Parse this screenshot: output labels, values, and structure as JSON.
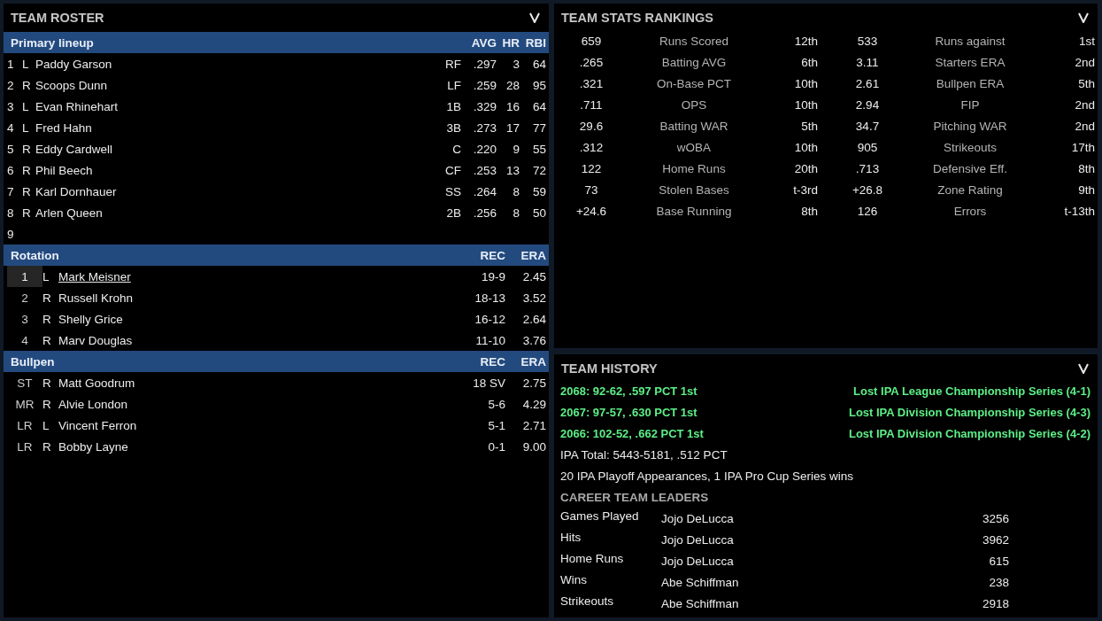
{
  "roster": {
    "title": "TEAM ROSTER",
    "sections": [
      {
        "kind": "lineup",
        "title": "Primary lineup",
        "columns": [
          "AVG",
          "HR",
          "RBI"
        ],
        "rows": [
          {
            "slot": "1",
            "hand": "L",
            "name": "Paddy Garson",
            "pos": "RF",
            "avg": ".297",
            "hr": "3",
            "rbi": "64",
            "selected": false
          },
          {
            "slot": "2",
            "hand": "R",
            "name": "Scoops Dunn",
            "pos": "LF",
            "avg": ".259",
            "hr": "28",
            "rbi": "95",
            "selected": false
          },
          {
            "slot": "3",
            "hand": "L",
            "name": "Evan Rhinehart",
            "pos": "1B",
            "avg": ".329",
            "hr": "16",
            "rbi": "64",
            "selected": false
          },
          {
            "slot": "4",
            "hand": "L",
            "name": "Fred Hahn",
            "pos": "3B",
            "avg": ".273",
            "hr": "17",
            "rbi": "77",
            "selected": false
          },
          {
            "slot": "5",
            "hand": "R",
            "name": "Eddy Cardwell",
            "pos": "C",
            "avg": ".220",
            "hr": "9",
            "rbi": "55",
            "selected": false
          },
          {
            "slot": "6",
            "hand": "R",
            "name": "Phil Beech",
            "pos": "CF",
            "avg": ".253",
            "hr": "13",
            "rbi": "72",
            "selected": false
          },
          {
            "slot": "7",
            "hand": "R",
            "name": "Karl Dornhauer",
            "pos": "SS",
            "avg": ".264",
            "hr": "8",
            "rbi": "59",
            "selected": false
          },
          {
            "slot": "8",
            "hand": "R",
            "name": "Arlen Queen",
            "pos": "2B",
            "avg": ".256",
            "hr": "8",
            "rbi": "50",
            "selected": false
          },
          {
            "slot": "9",
            "selected": false
          }
        ]
      },
      {
        "kind": "pitchers",
        "title": "Rotation",
        "columns": [
          "REC",
          "ERA"
        ],
        "rows": [
          {
            "role": "1",
            "hand": "L",
            "name": "Mark Meisner",
            "rec": "19-9",
            "era": "2.45",
            "selected": true
          },
          {
            "role": "2",
            "hand": "R",
            "name": "Russell Krohn",
            "rec": "18-13",
            "era": "3.52",
            "selected": false
          },
          {
            "role": "3",
            "hand": "R",
            "name": "Shelly Grice",
            "rec": "16-12",
            "era": "2.64",
            "selected": false
          },
          {
            "role": "4",
            "hand": "R",
            "name": "Marv Douglas",
            "rec": "11-10",
            "era": "3.76",
            "selected": false
          }
        ]
      },
      {
        "kind": "pitchers",
        "title": "Bullpen",
        "columns": [
          "REC",
          "ERA"
        ],
        "rows": [
          {
            "role": "ST",
            "hand": "R",
            "name": "Matt Goodrum",
            "rec": "18 SV",
            "era": "2.75",
            "selected": false
          },
          {
            "role": "MR",
            "hand": "R",
            "name": "Alvie London",
            "rec": "5-6",
            "era": "4.29",
            "selected": false
          },
          {
            "role": "LR",
            "hand": "L",
            "name": "Vincent Ferron",
            "rec": "5-1",
            "era": "2.71",
            "selected": false
          },
          {
            "role": "LR",
            "hand": "R",
            "name": "Bobby Layne",
            "rec": "0-1",
            "era": "9.00",
            "selected": false
          }
        ]
      }
    ]
  },
  "stats": {
    "title": "TEAM STATS RANKINGS",
    "rows": [
      {
        "value": "659",
        "label": "Runs Scored",
        "rank": "12th",
        "value_2": "533",
        "label_2": "Runs against",
        "rank_2": "1st"
      },
      {
        "value": ".265",
        "label": "Batting AVG",
        "rank": "6th",
        "value_2": "3.11",
        "label_2": "Starters ERA",
        "rank_2": "2nd"
      },
      {
        "value": ".321",
        "label": "On-Base PCT",
        "rank": "10th",
        "value_2": "2.61",
        "label_2": "Bullpen ERA",
        "rank_2": "5th"
      },
      {
        "value": ".711",
        "label": "OPS",
        "rank": "10th",
        "value_2": "2.94",
        "label_2": "FIP",
        "rank_2": "2nd"
      },
      {
        "value": "29.6",
        "label": "Batting WAR",
        "rank": "5th",
        "value_2": "34.7",
        "label_2": "Pitching WAR",
        "rank_2": "2nd"
      },
      {
        "value": ".312",
        "label": "wOBA",
        "rank": "10th",
        "value_2": "905",
        "label_2": "Strikeouts",
        "rank_2": "17th"
      },
      {
        "value": "122",
        "label": "Home Runs",
        "rank": "20th",
        "value_2": ".713",
        "label_2": "Defensive Eff.",
        "rank_2": "8th"
      },
      {
        "value": "73",
        "label": "Stolen Bases",
        "rank": "t-3rd",
        "value_2": "+26.8",
        "label_2": "Zone Rating",
        "rank_2": "9th"
      },
      {
        "value": "+24.6",
        "label": "Base Running",
        "rank": "8th",
        "value_2": "126",
        "label_2": "Errors",
        "rank_2": "t-13th"
      }
    ]
  },
  "history": {
    "title": "TEAM HISTORY",
    "seasons": [
      {
        "record": "2068: 92-62, .597 PCT 1st",
        "result": "Lost IPA League Championship Series  (4-1)"
      },
      {
        "record": "2067: 97-57, .630 PCT 1st",
        "result": "Lost IPA Division Championship Series (4-3)"
      },
      {
        "record": "2066: 102-52, .662 PCT 1st",
        "result": "Lost IPA Division Championship Series (4-2)"
      }
    ],
    "total": "IPA Total: 5443-5181, .512 PCT",
    "playoffs": "20 IPA Playoff Appearances, 1 IPA Pro Cup Series wins",
    "leaders_title": "CAREER TEAM LEADERS",
    "leaders": [
      {
        "category": "Games Played",
        "player": "Jojo DeLucca",
        "value": "3256"
      },
      {
        "category": "Hits",
        "player": "Jojo DeLucca",
        "value": "3962"
      },
      {
        "category": "Home Runs",
        "player": "Jojo DeLucca",
        "value": "615"
      },
      {
        "category": "Wins",
        "player": "Abe Schiffman",
        "value": "238"
      },
      {
        "category": "Strikeouts",
        "player": "Abe Schiffman",
        "value": "2918"
      }
    ]
  }
}
